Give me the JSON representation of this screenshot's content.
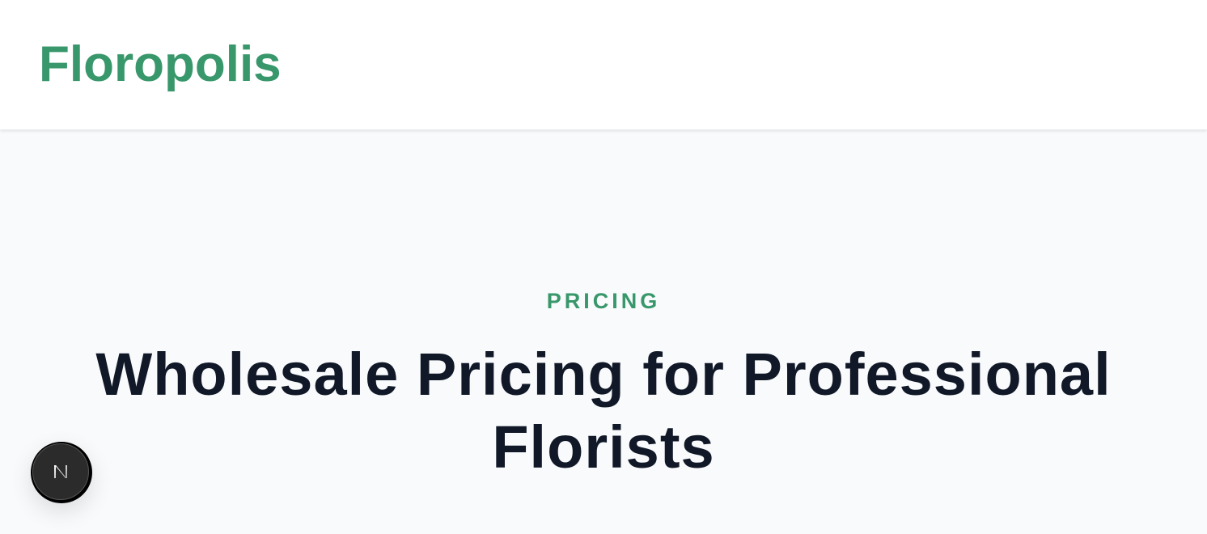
{
  "header": {
    "brand": "Floropolis"
  },
  "hero": {
    "eyebrow": "PRICING",
    "title": "Wholesale Pricing for Professional Florists"
  },
  "dev_badge": {
    "icon": "nextjs-logo-icon"
  },
  "colors": {
    "brand": "#38976b",
    "heading": "#111827",
    "page_background": "#f8fafc",
    "header_background": "#ffffff"
  }
}
